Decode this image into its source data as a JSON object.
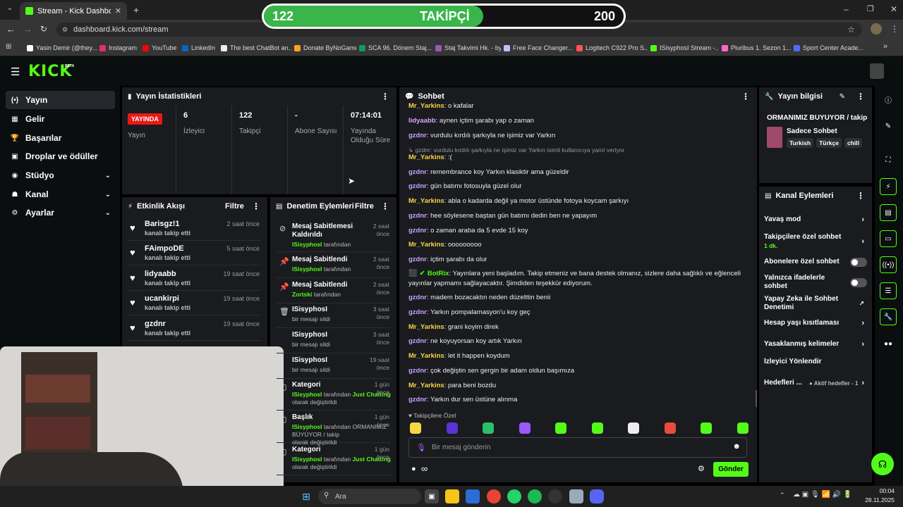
{
  "browser": {
    "tab_title": "Stream - Kick Dashboard",
    "url": "dashboard.kick.com/stream",
    "bookmarks": [
      {
        "label": "Yasin Demir (@they...",
        "color": "#ffffff"
      },
      {
        "label": "Instagram",
        "color": "#e1306c"
      },
      {
        "label": "YouTube",
        "color": "#ff0000"
      },
      {
        "label": "LinkedIn",
        "color": "#0a66c2"
      },
      {
        "label": "The best ChatBot an...",
        "color": "#eeeeee"
      },
      {
        "label": "Donate ByNoGame",
        "color": "#f5a623"
      },
      {
        "label": "SCA 96. Dönem Staj...",
        "color": "#0f9d58"
      },
      {
        "label": "Staj Takvimi Hk. - by...",
        "color": "#9b59b6"
      },
      {
        "label": "Free Face Changer...",
        "color": "#c0c0ff"
      },
      {
        "label": "Logitech C922 Pro S...",
        "color": "#ff5555"
      },
      {
        "label": "ISisyphosI Stream -...",
        "color": "#53fc18"
      },
      {
        "label": "Pluribus 1. Sezon 1....",
        "color": "#ff66cc"
      },
      {
        "label": "Sport Center Acade...",
        "color": "#4f6ef7"
      }
    ]
  },
  "overlay": {
    "current": "122",
    "label": "TAKİPÇİ",
    "goal": "200",
    "progress": 0.61
  },
  "kick": {
    "logo": "KICK",
    "beta": "BETA"
  },
  "sidebar": {
    "items": [
      {
        "label": "Yayın",
        "icon": "(•)"
      },
      {
        "label": "Gelir",
        "icon": "▦"
      },
      {
        "label": "Başarılar",
        "icon": "🏆"
      },
      {
        "label": "Droplar ve ödüller",
        "icon": "▣"
      },
      {
        "label": "Stüdyo",
        "icon": "◉"
      },
      {
        "label": "Kanal",
        "icon": "☗"
      },
      {
        "label": "Ayarlar",
        "icon": "⚙"
      }
    ]
  },
  "stats": {
    "title": "Yayın İstatistikleri",
    "live_badge": "YAYINDA",
    "live_label": "Yayın",
    "cols": [
      {
        "value": "6",
        "label": "İzleyici"
      },
      {
        "value": "122",
        "label": "Takipçi"
      },
      {
        "value": "-",
        "label": "Abone Sayısı"
      },
      {
        "value": "07:14:01",
        "label": "Yayında Olduğu Süre"
      }
    ]
  },
  "activity": {
    "title": "Etkinlik Akışı",
    "filter": "Filtre",
    "items": [
      {
        "name": "Barisgz!1",
        "sub": "kanalı takip etti",
        "time": "2 saat önce"
      },
      {
        "name": "FAimpoDE",
        "sub": "kanalı takip etti",
        "time": "5 saat önce"
      },
      {
        "name": "lidyaabb",
        "sub": "kanalı takip etti",
        "time": "19 saat önce"
      },
      {
        "name": "ucankirpi",
        "sub": "kanalı takip etti",
        "time": "19 saat önce"
      },
      {
        "name": "gzdnr",
        "sub": "kanalı takip etti",
        "time": "19 saat önce"
      }
    ]
  },
  "moderation": {
    "title": "Denetim Eylemleri",
    "filter": "Filtre",
    "items": [
      {
        "icon": "⊘",
        "title": "Mesaj Sabitlemesi Kaldırıldı",
        "user": "ISisyphosI",
        "rest": "tarafından",
        "time": "2 saat önce"
      },
      {
        "icon": "📌",
        "title": "Mesaj Sabitlendi",
        "user": "ISisyphosI",
        "rest": "tarafından",
        "time": "2 saat önce"
      },
      {
        "icon": "📌",
        "title": "Mesaj Sabitlendi",
        "user": "Zortski",
        "rest": "tarafından",
        "time": "2 saat önce"
      },
      {
        "icon": "🗑",
        "title": "ISisyphosI",
        "user": "",
        "rest": "bir mesajı sildi",
        "time": "3 saat önce"
      },
      {
        "icon": "",
        "title": "ISisyphosI",
        "user": "",
        "rest": "bir mesajı sildi",
        "time": "3 saat önce"
      },
      {
        "icon": "",
        "title": "ISisyphosI",
        "user": "",
        "rest": "bir mesajı sildi",
        "time": "19 saat önce"
      },
      {
        "icon": "▢",
        "title": "Kategori",
        "user": "ISisyphosI",
        "rest": "tarafından",
        "extra": "Just Chatting",
        "tail": "olarak değiştirildi",
        "time": "1 gün önce"
      },
      {
        "icon": "▢",
        "title": "Başlık",
        "user": "ISisyphosI",
        "rest": "tarafından ORMANIMIZ BÜYÜYOR / takip",
        "extra": "",
        "tail": "olarak değiştirildi",
        "time": "1 gün önce"
      },
      {
        "icon": "▢",
        "title": "Kategori",
        "user": "ISisyphosI",
        "rest": "tarafından",
        "extra": "Just Chatting",
        "tail": "olarak değiştirildi",
        "time": "1 gün önce"
      }
    ]
  },
  "chat": {
    "title": "Sohbet",
    "messages": [
      {
        "user": "Mr_Yarkins",
        "color": "#f5d742",
        "text": "o kafalar"
      },
      {
        "user": "lidyaabb",
        "color": "#d7a6ff",
        "text": "aynen içtim şarabı yap o zaman"
      },
      {
        "user": "gzdnr",
        "color": "#c8a2ff",
        "text": "vurdulu kırdılı şarkıyla ne işimiz var Yarkın"
      },
      {
        "user": "",
        "color": "#999999",
        "text": "↳ gzdnr: vurdulu kırdılı şarkıyla ne işimiz var Yarkın isimli kullanıcıya yanıt veriyor"
      },
      {
        "user": "Mr_Yarkins",
        "color": "#f5d742",
        "text": ":("
      },
      {
        "user": "gzdnr",
        "color": "#c8a2ff",
        "text": "remembrance koy Yarkın klasiktir ama güzeldir"
      },
      {
        "user": "gzdnr",
        "color": "#c8a2ff",
        "text": "gün batımı fotosuyla güzel olur"
      },
      {
        "user": "Mr_Yarkins",
        "color": "#f5d742",
        "text": "abla o kadarda değil ya motor üstünde fotoya koycam şarkıyı"
      },
      {
        "user": "gzdnr",
        "color": "#c8a2ff",
        "text": "hee söylesene baştan gün batımı dedin ben ne yapayım"
      },
      {
        "user": "gzdnr",
        "color": "#c8a2ff",
        "text": "o zaman araba da 5 evde 15 koy"
      },
      {
        "user": "Mr_Yarkins",
        "color": "#f5d742",
        "text": "ooooooooo"
      },
      {
        "user": "gzdnr",
        "color": "#c8a2ff",
        "text": "içtim şarabı da olur"
      },
      {
        "user": "BotRix",
        "color": "#53fc18",
        "text": "Yayınlara yeni başladım. Takip etmeniz ve bana destek olmanız, sizlere daha sağlıklı ve eğlenceli yayınlar yapmamı sağlayacaktır. Şimdiden teşekkür ediyorum."
      },
      {
        "user": "gzdnr",
        "color": "#c8a2ff",
        "text": "madem bozacaktın neden düzelttin benii"
      },
      {
        "user": "gzdnr",
        "color": "#c8a2ff",
        "text": "Yarkın pompalamasyon'u koy geç"
      },
      {
        "user": "Mr_Yarkins",
        "color": "#f5d742",
        "text": "grani koyim direk"
      },
      {
        "user": "gzdnr",
        "color": "#c8a2ff",
        "text": "ne koyuyorsan koy artık Yarkın"
      },
      {
        "user": "Mr_Yarkins",
        "color": "#f5d742",
        "text": "let it happen koydum"
      },
      {
        "user": "gzdnr",
        "color": "#c8a2ff",
        "text": "çok değiştin sen gergin bir adam oldun başımıza"
      },
      {
        "user": "Mr_Yarkins",
        "color": "#f5d742",
        "text": "para beni bozdu"
      },
      {
        "user": "gzdnr",
        "color": "#c8a2ff",
        "text": "Yarkın dur sen üstüne alınma"
      }
    ],
    "followers_only": "♥ Takipçilere Özel",
    "placeholder": "Bir mesaj gönderin",
    "send": "Gönder",
    "inf": "∞"
  },
  "stream_info": {
    "title": "Yayın bilgisi",
    "stream_title": "ORMANIMIZ BÜYÜYOR / takip",
    "category": "Sadece Sohbet",
    "tags": [
      "Turkish",
      "Türkçe",
      "chill"
    ]
  },
  "channel_actions": {
    "title": "Kanal Eylemleri",
    "rows": [
      {
        "label": "Yavaş mod",
        "type": "chev",
        "sub": ""
      },
      {
        "label": "Takipçilere özel sohbet",
        "type": "chev",
        "sub": "1 dk."
      },
      {
        "label": "Abonelere özel sohbet",
        "type": "toggle",
        "sub": ""
      },
      {
        "label": "Yalnızca ifadelerle sohbet",
        "type": "toggle",
        "sub": ""
      },
      {
        "label": "Yapay Zeka ile Sohbet Denetimi",
        "type": "ext",
        "sub": ""
      },
      {
        "label": "Hesap yaşı kısıtlaması",
        "type": "chev",
        "sub": ""
      },
      {
        "label": "Yasaklanmış kelimeler",
        "type": "chev",
        "sub": ""
      },
      {
        "label": "İzleyici Yönlendir",
        "type": "none",
        "sub": ""
      },
      {
        "label": "Hedefleri ...",
        "type": "chev",
        "sub": "● Aktif hedefler - 1"
      }
    ]
  },
  "taskbar": {
    "search": "Ara",
    "time": "00:04",
    "date": "28.11.2025"
  },
  "colors": {
    "accent": "#53fc18",
    "live": "#e91916",
    "panel": "#191b1f"
  }
}
